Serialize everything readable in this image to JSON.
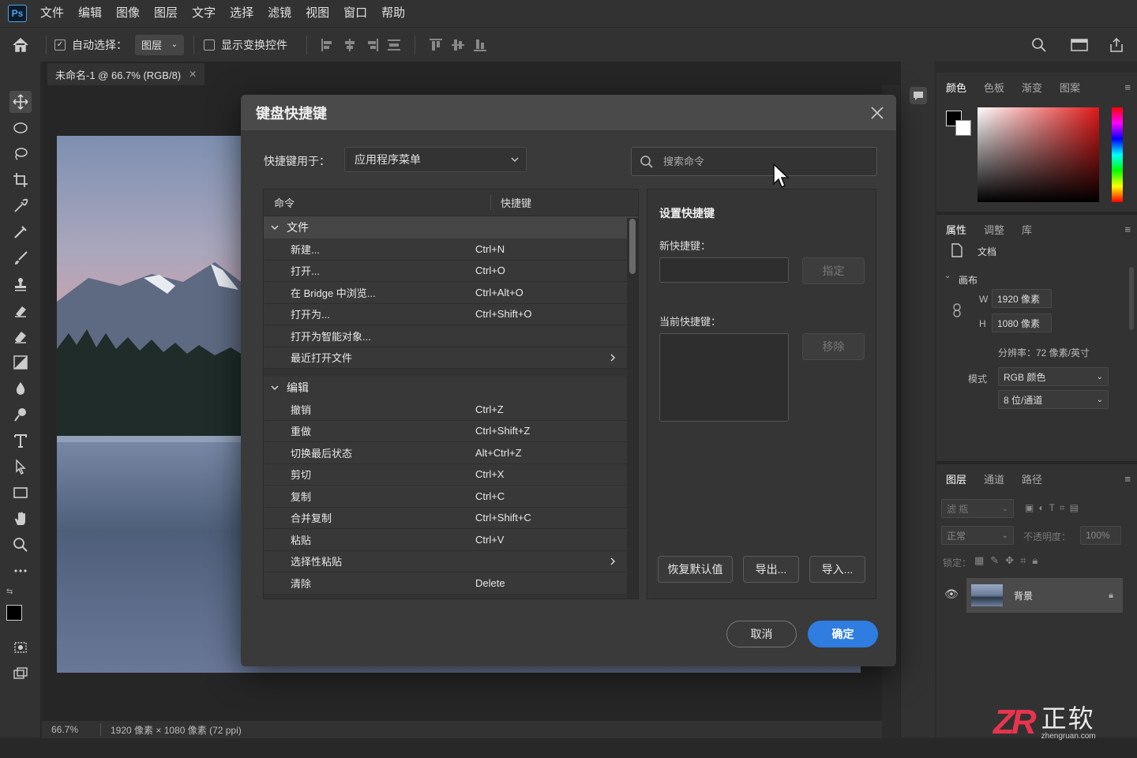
{
  "app": {
    "logo": "Ps"
  },
  "menu": [
    "文件",
    "编辑",
    "图像",
    "图层",
    "文字",
    "选择",
    "滤镜",
    "视图",
    "窗口",
    "帮助"
  ],
  "options": {
    "auto_select_label": "自动选择：",
    "auto_select_value": "图层",
    "show_transform_label": "显示变换控件"
  },
  "document": {
    "tab_title": "未命名-1 @ 66.7% (RGB/8)",
    "zoom": "66.7%",
    "size_info": "1920 像素 × 1080 像素 (72 ppi)"
  },
  "right": {
    "color_tabs": [
      "颜色",
      "色板",
      "渐变",
      "图案"
    ],
    "prop_tabs": [
      "属性",
      "调整",
      "库"
    ],
    "doc_label": "文档",
    "canvas_label": "画布",
    "w_label": "W",
    "w_value": "1920 像素",
    "h_label": "H",
    "h_value": "1080 像素",
    "resolution": "分辨率：72 像素/英寸",
    "mode_label": "模式",
    "mode_value": "RGB 颜色",
    "depth_value": "8 位/通道",
    "layer_tabs": [
      "图层",
      "通道",
      "路径"
    ],
    "filter_placeholder": "滤 瓶",
    "blend_mode": "正常",
    "opacity_label": "不透明度：",
    "opacity_value": "100%",
    "lock_label": "锁定：",
    "layer_name": "背景"
  },
  "dialog": {
    "title": "键盘快捷键",
    "shortcuts_for_label": "快捷键用于：",
    "shortcuts_for_value": "应用程序菜单",
    "search_placeholder": "搜索命令",
    "col_command": "命令",
    "col_shortcut": "快捷键",
    "groups": [
      {
        "name": "文件",
        "rows": [
          {
            "cmd": "新建...",
            "key": "Ctrl+N"
          },
          {
            "cmd": "打开...",
            "key": "Ctrl+O"
          },
          {
            "cmd": "在 Bridge 中浏览...",
            "key": "Ctrl+Alt+O"
          },
          {
            "cmd": "打开为...",
            "key": "Ctrl+Shift+O"
          },
          {
            "cmd": "打开为智能对象...",
            "key": ""
          },
          {
            "cmd": "最近打开文件",
            "key": "",
            "sub": true
          }
        ]
      },
      {
        "name": "编辑",
        "rows": [
          {
            "cmd": "撤销",
            "key": "Ctrl+Z"
          },
          {
            "cmd": "重做",
            "key": "Ctrl+Shift+Z"
          },
          {
            "cmd": "切换最后状态",
            "key": "Alt+Ctrl+Z"
          },
          {
            "cmd": "剪切",
            "key": "Ctrl+X"
          },
          {
            "cmd": "复制",
            "key": "Ctrl+C"
          },
          {
            "cmd": "合并复制",
            "key": "Ctrl+Shift+C"
          },
          {
            "cmd": "粘贴",
            "key": "Ctrl+V"
          },
          {
            "cmd": "选择性粘贴",
            "key": "",
            "sub": true
          },
          {
            "cmd": "清除",
            "key": "Delete"
          }
        ]
      }
    ],
    "set_title": "设置快捷键",
    "new_shortcut_label": "新快捷键：",
    "assign_label": "指定",
    "current_shortcut_label": "当前快捷键：",
    "remove_label": "移除",
    "restore_label": "恢复默认值",
    "export_label": "导出...",
    "import_label": "导入...",
    "cancel_label": "取消",
    "ok_label": "确定"
  },
  "watermark": {
    "brand": "ZR",
    "name": "正软",
    "url": "zhengruan.com"
  },
  "colors": {
    "accent": "#2f7de0",
    "panel": "#323232",
    "dialog": "#3a3a3a"
  }
}
